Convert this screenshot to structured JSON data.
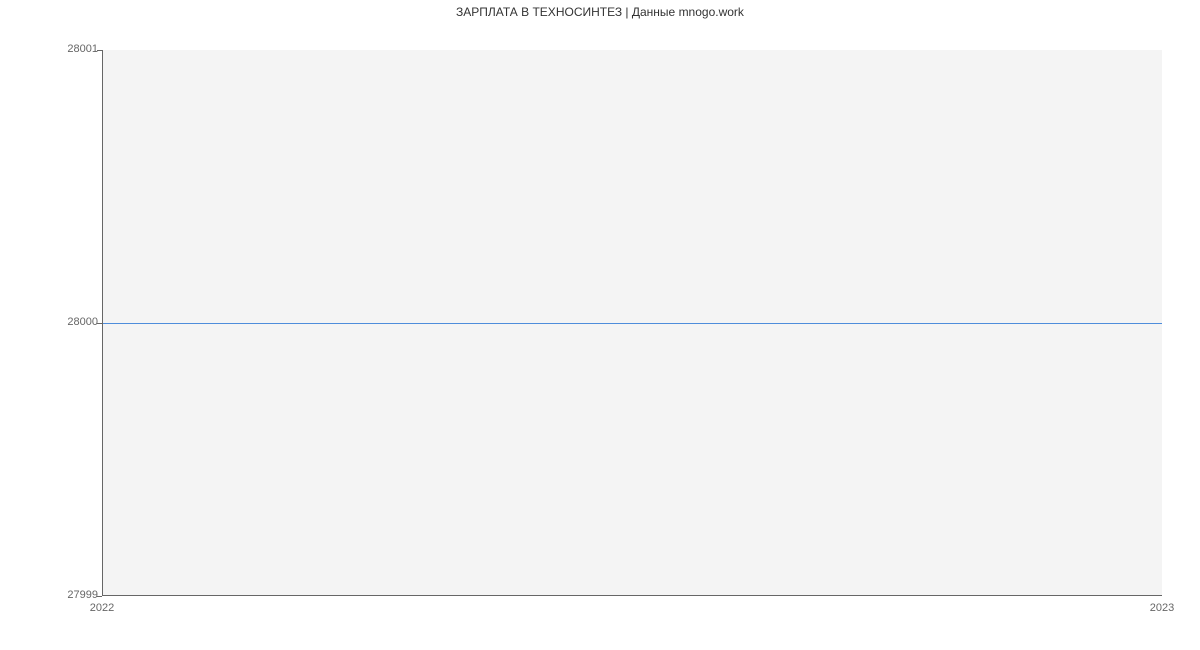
{
  "chart_data": {
    "type": "line",
    "title": "ЗАРПЛАТА В ТЕХНОСИНТЕЗ | Данные mnogo.work",
    "xlabel": "",
    "ylabel": "",
    "x": [
      2022,
      2023
    ],
    "values": [
      28000,
      28000
    ],
    "ylim": [
      27999,
      28001
    ],
    "xlim": [
      2022,
      2023
    ],
    "x_ticks": [
      {
        "value": 2022,
        "label": "2022"
      },
      {
        "value": 2023,
        "label": "2023"
      }
    ],
    "y_ticks": [
      {
        "value": 27999,
        "label": "27999"
      },
      {
        "value": 28000,
        "label": "28000"
      },
      {
        "value": 28001,
        "label": "28001"
      }
    ],
    "line_color": "#4e8ddb",
    "plot_bg": "#f4f4f4"
  }
}
